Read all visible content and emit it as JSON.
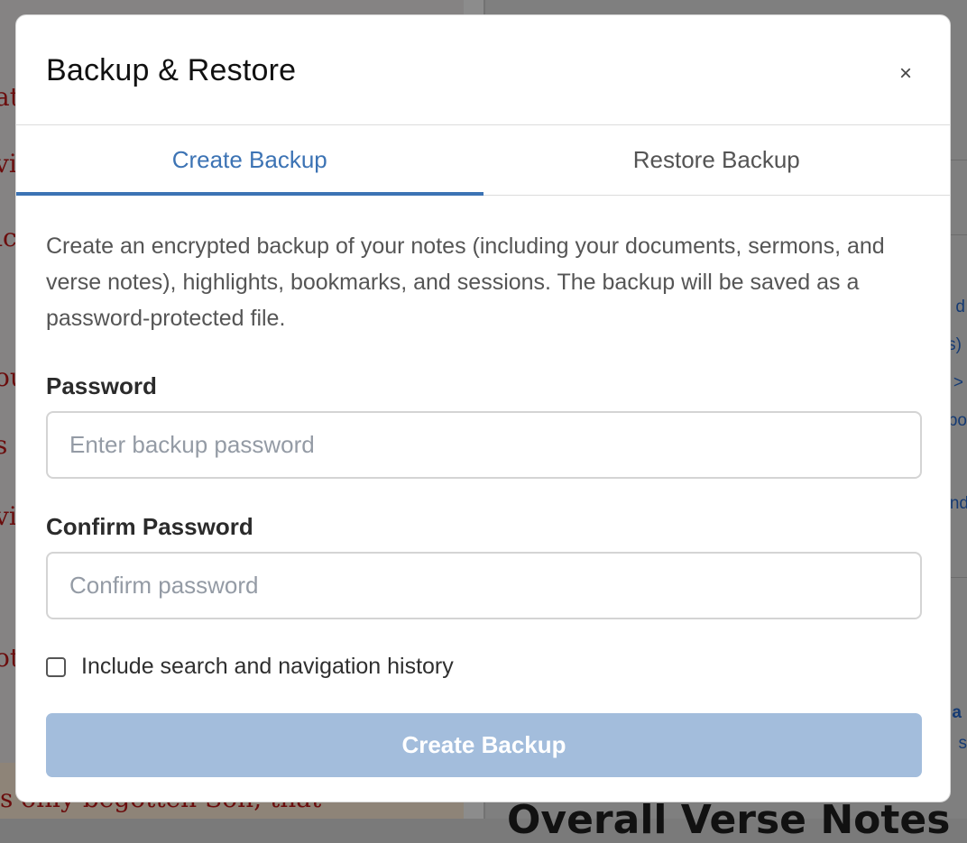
{
  "background": {
    "scripture_fragments": [
      "at",
      "vi",
      "ic",
      "ou",
      "s",
      "vi",
      "ot"
    ],
    "scripture_footer": "s only begotten Son, that",
    "notes_fragments": [
      "d",
      "s)",
      ">",
      "bo",
      "nd",
      "a",
      "s"
    ],
    "notes_heading": "Overall Verse Notes"
  },
  "modal": {
    "title": "Backup & Restore",
    "close_symbol": "×",
    "tabs": [
      {
        "label": "Create Backup",
        "active": true
      },
      {
        "label": "Restore Backup",
        "active": false
      }
    ],
    "description": "Create an encrypted backup of your notes (including your documents, sermons, and verse notes), highlights, bookmarks, and sessions. The backup will be saved as a password-protected file.",
    "password": {
      "label": "Password",
      "placeholder": "Enter backup password",
      "value": ""
    },
    "confirm_password": {
      "label": "Confirm Password",
      "placeholder": "Confirm password",
      "value": ""
    },
    "include_history": {
      "label": "Include search and navigation history",
      "checked": false
    },
    "submit": {
      "label": "Create Backup",
      "disabled": true
    }
  },
  "colors": {
    "accent": "#3c73b4",
    "button_disabled": "#a3bddc",
    "scripture_text": "#6b0d0d"
  }
}
